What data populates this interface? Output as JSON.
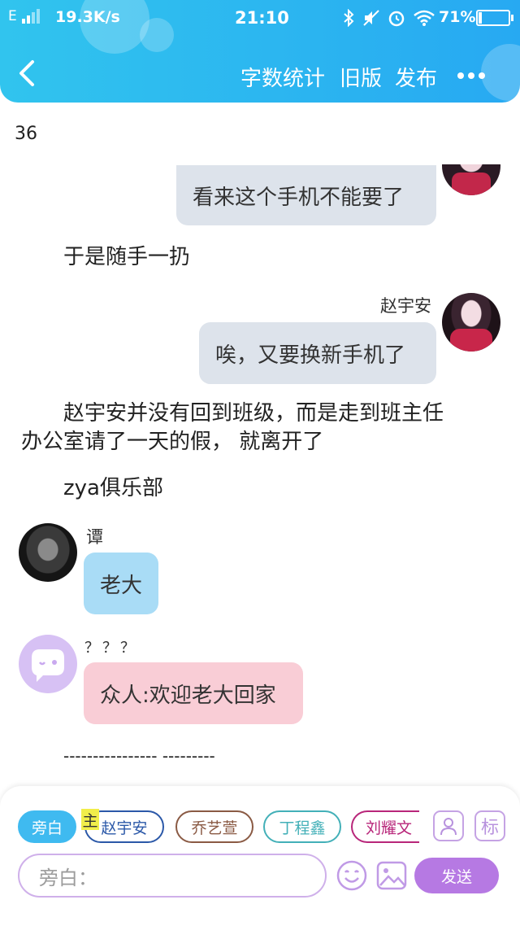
{
  "status_bar": {
    "network": "E",
    "speed": "19.3K/s",
    "time": "21:10",
    "battery": "71%"
  },
  "nav": {
    "back_icon": "chevron-left-icon",
    "word_count_label": "字数统计",
    "old_version_label": "旧版",
    "publish_label": "发布",
    "more_icon": "more-dots-icon"
  },
  "word_count": "36",
  "story": {
    "msg_top_partial": "看来这个手机不能要了",
    "narration_1": "于是随手一扔",
    "speaker_zya": "赵宇安",
    "msg_zya": "唉，又要换新手机了",
    "narration_2_line1": "赵宇安并没有回到班级，而是走到班主任",
    "narration_2_line2": "办公室请了一天的假， 就离开了",
    "narration_3": "zya俱乐部",
    "speaker_tan": "谭",
    "msg_tan": "老大",
    "speaker_unknown": "？？？",
    "msg_unknown": "众人:欢迎老大回家",
    "dashes": "---------------- ---------"
  },
  "composer": {
    "chip_narrator": "旁白",
    "main_badge": "主",
    "chips": [
      "赵宇安",
      "乔艺萱",
      "丁程鑫",
      "刘耀文"
    ],
    "tag_button": "标",
    "input_placeholder": "旁白：",
    "send_label": "发送"
  },
  "colors": {
    "header_blue": "#2bb4f0",
    "bubble_grey": "#dde3eb",
    "bubble_blue": "#a9dcf6",
    "bubble_pink": "#f9cdd6",
    "accent_purple": "#b679e3"
  }
}
